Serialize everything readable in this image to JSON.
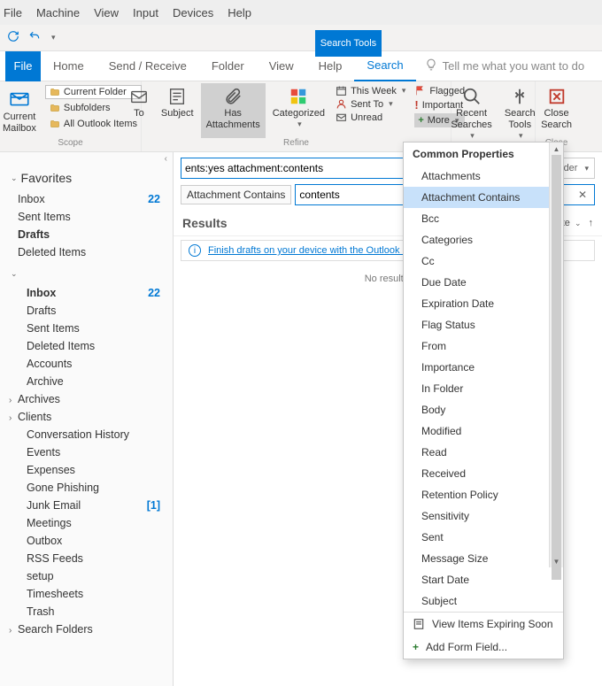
{
  "system_menu": [
    "File",
    "Machine",
    "View",
    "Input",
    "Devices",
    "Help"
  ],
  "search_tools_label": "Search Tools",
  "ribbon_tabs": {
    "file": "File",
    "items": [
      "Home",
      "Send / Receive",
      "Folder",
      "View",
      "Help",
      "Search"
    ],
    "active": "Search",
    "tell_me_placeholder": "Tell me what you want to do"
  },
  "ribbon": {
    "scope": {
      "current_mailbox": "Current\nMailbox",
      "current_folder": "Current Folder",
      "subfolders": "Subfolders",
      "all_items": "All Outlook Items",
      "group": "Scope"
    },
    "refine": {
      "to": "To",
      "subject": "Subject",
      "has_attachments": "Has\nAttachments",
      "categorized": "Categorized",
      "this_week": "This Week",
      "sent_to": "Sent To",
      "unread": "Unread",
      "flagged": "Flagged",
      "important": "Important",
      "more": "More",
      "group": "Refine"
    },
    "options": {
      "recent": "Recent\nSearches",
      "tools": "Search\nTools"
    },
    "close": {
      "label": "Close\nSearch",
      "group": "Close"
    }
  },
  "nav": {
    "favorites_hdr": "Favorites",
    "favorites": [
      {
        "name": "Inbox",
        "count": "22"
      },
      {
        "name": "Sent Items"
      },
      {
        "name": "Drafts",
        "bold": true
      },
      {
        "name": "Deleted Items"
      }
    ],
    "folders": [
      {
        "name": "Inbox",
        "count": "22",
        "bold": true
      },
      {
        "name": "Drafts"
      },
      {
        "name": "Sent Items"
      },
      {
        "name": "Deleted Items"
      },
      {
        "name": "Accounts"
      },
      {
        "name": "Archive"
      },
      {
        "name": "Archives",
        "expand": true
      },
      {
        "name": "Clients",
        "expand": true
      },
      {
        "name": "Conversation History"
      },
      {
        "name": "Events"
      },
      {
        "name": "Expenses"
      },
      {
        "name": "Gone Phishing"
      },
      {
        "name": "Junk Email",
        "count": "[1]"
      },
      {
        "name": "Meetings"
      },
      {
        "name": "Outbox"
      },
      {
        "name": "RSS Feeds"
      },
      {
        "name": "setup"
      },
      {
        "name": "Timesheets"
      },
      {
        "name": "Trash"
      },
      {
        "name": "Search Folders",
        "expand": true
      }
    ]
  },
  "search": {
    "query": "ents:yes attachment:contents",
    "scope_dd": "Current Folder",
    "filter_label": "Attachment Contains",
    "filter_value": "contents",
    "results_hdr": "Results",
    "sort_label": "By Date",
    "banner_link": "Finish drafts on your device with the Outlook app",
    "no_results": "No results."
  },
  "more_menu": {
    "header": "Common Properties",
    "items": [
      "Attachments",
      "Attachment Contains",
      "Bcc",
      "Categories",
      "Cc",
      "Due Date",
      "Expiration Date",
      "Flag Status",
      "From",
      "Importance",
      "In Folder",
      "Body",
      "Modified",
      "Read",
      "Received",
      "Retention Policy",
      "Sensitivity",
      "Sent",
      "Message Size",
      "Start Date",
      "Subject"
    ],
    "hover": "Attachment Contains",
    "footer_view": "View Items Expiring Soon",
    "footer_add": "Add Form Field..."
  }
}
